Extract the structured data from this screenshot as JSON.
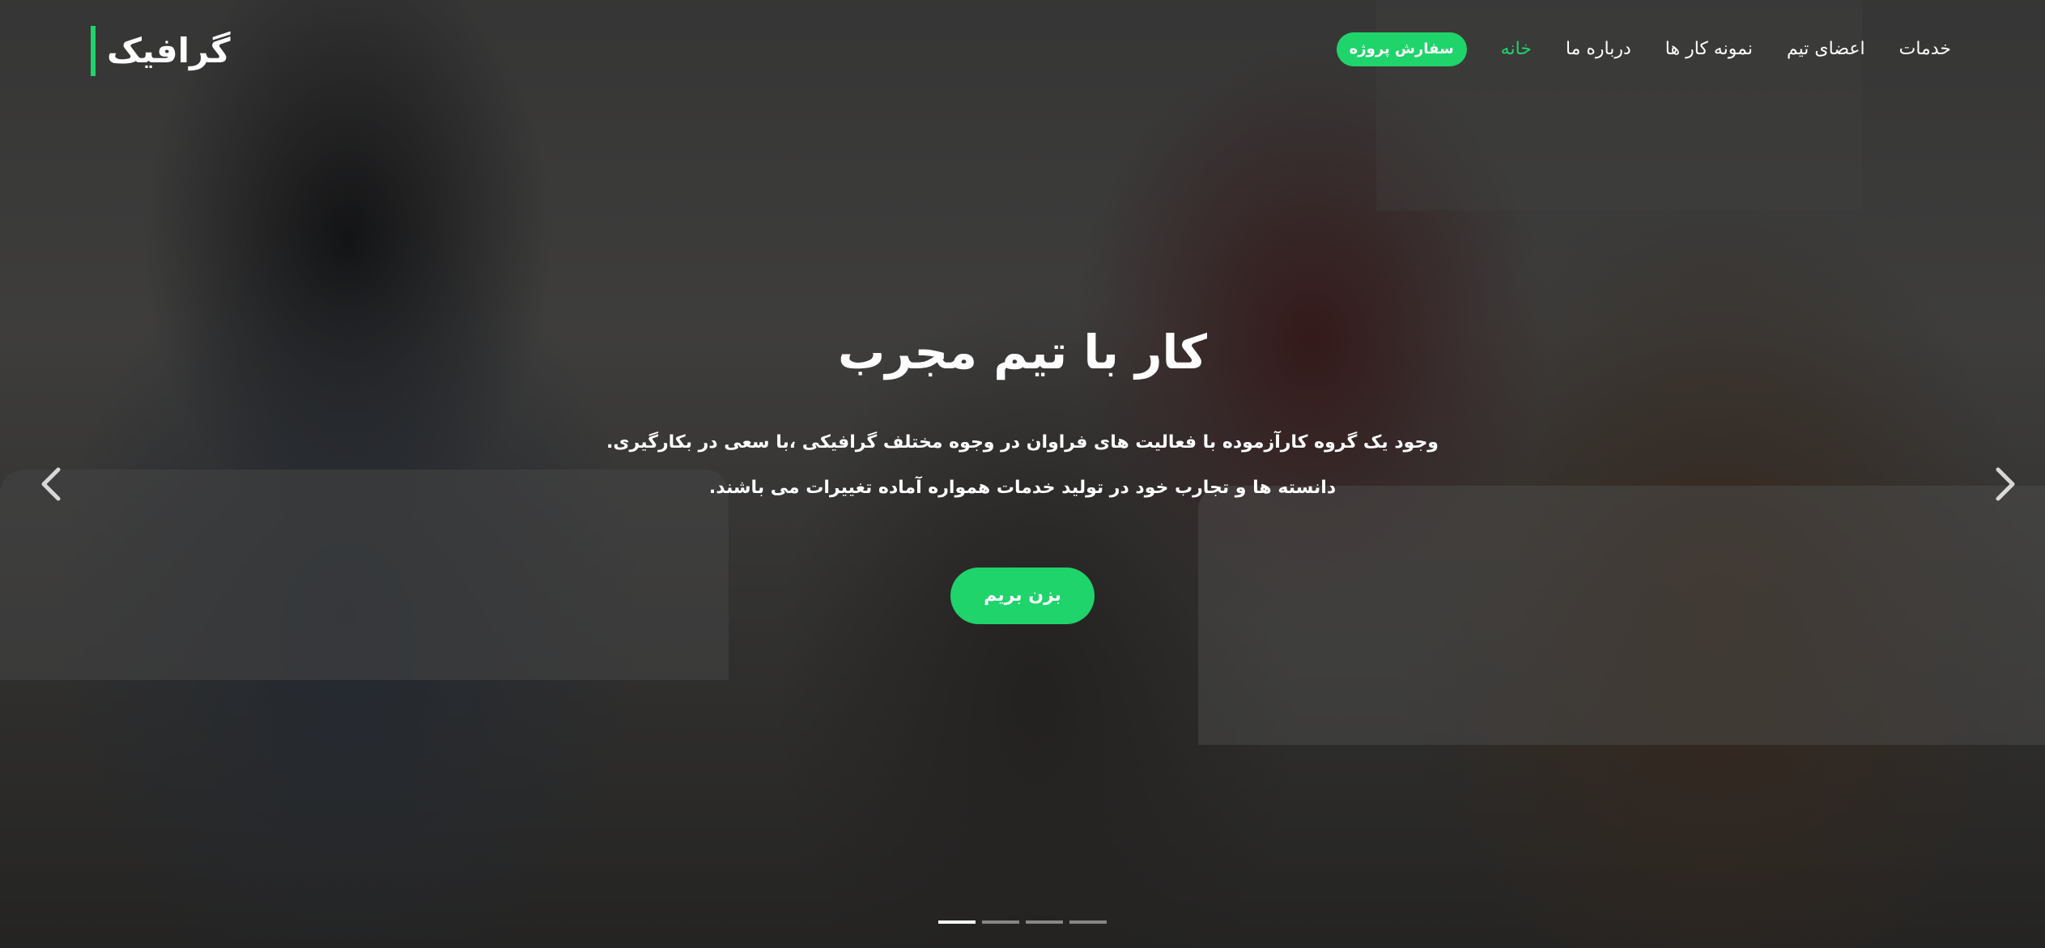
{
  "logo": {
    "text": "گرافیک"
  },
  "nav": {
    "items": [
      {
        "label": "خدمات",
        "active": false
      },
      {
        "label": "اعضای تیم",
        "active": false
      },
      {
        "label": "نمونه کار ها",
        "active": false
      },
      {
        "label": "درباره ما",
        "active": false
      },
      {
        "label": "خانه",
        "active": true
      }
    ],
    "cta_label": "سفارش پروژه"
  },
  "hero": {
    "title": "کار با تیم مجرب",
    "line1": "وجود یک گروه کارآزموده با فعالیت های فراوان در وجوه مختلف گرافیکی ،با سعی در بکارگیری.",
    "line2": "دانسته ها و تجارب خود در تولید خدمات همواره آماده تغییرات می باشند.",
    "button_label": "بزن بریم"
  },
  "carousel": {
    "prev_icon": "chevron-left-icon",
    "next_icon": "chevron-right-icon",
    "slide_count": 4,
    "active_index": 0
  },
  "colors": {
    "accent": "#1ed46b",
    "text": "#ffffff",
    "overlay": "rgba(0,0,0,0.42)"
  }
}
